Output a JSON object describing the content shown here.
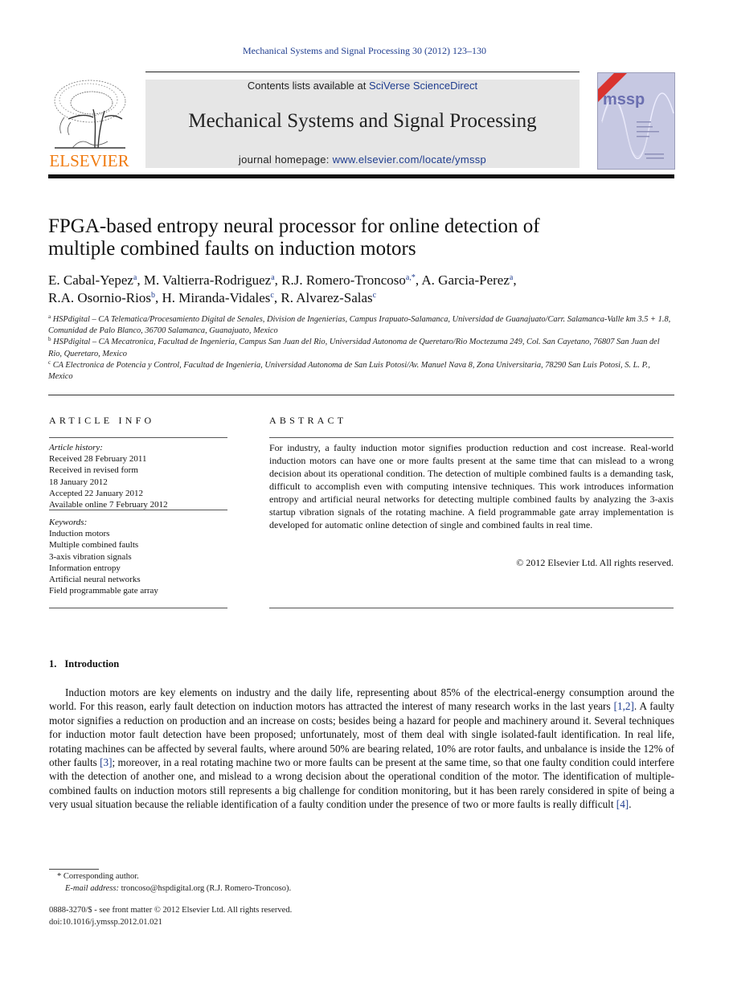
{
  "running_head": "Mechanical Systems and Signal Processing 30 (2012) 123–130",
  "masthead": {
    "publisher_logo_text": "ELSEVIER",
    "contents_prefix": "Contents lists available at ",
    "contents_link": "SciVerse ScienceDirect",
    "journal_title": "Mechanical Systems and Signal Processing",
    "homepage_prefix": "journal homepage: ",
    "homepage_link": "www.elsevier.com/locate/ymssp",
    "cover_title": "mssp"
  },
  "colors": {
    "link": "#1f3d8f",
    "elsevier_orange": "#f07b10",
    "masthead_bg": "#e6e6e6"
  },
  "article": {
    "title_line1": "FPGA-based entropy neural processor for online detection of",
    "title_line2": "multiple combined faults on induction motors",
    "authors": [
      {
        "name": "E. Cabal-Yepez",
        "aff": "a",
        "sep": ", "
      },
      {
        "name": "M. Valtierra-Rodriguez",
        "aff": "a",
        "sep": ", "
      },
      {
        "name": "R.J. Romero-Troncoso",
        "aff": "a,*",
        "sep": ", "
      },
      {
        "name": "A. Garcia-Perez",
        "aff": "a",
        "sep": ","
      },
      {
        "name": "R.A. Osornio-Rios",
        "aff": "b",
        "sep": ", "
      },
      {
        "name": "H. Miranda-Vidales",
        "aff": "c",
        "sep": ", "
      },
      {
        "name": "R. Alvarez-Salas",
        "aff": "c",
        "sep": ""
      }
    ],
    "affiliations": [
      {
        "mark": "a",
        "text": "HSPdigital – CA Telematica/Procesamiento Digital de Senales, Division de Ingenierias, Campus Irapuato-Salamanca, Universidad de Guanajuato/Carr. Salamanca-Valle km 3.5 + 1.8, Comunidad de Palo Blanco, 36700 Salamanca, Guanajuato, Mexico"
      },
      {
        "mark": "b",
        "text": "HSPdigital – CA Mecatronica, Facultad de Ingenieria, Campus San Juan del Rio, Universidad Autonoma de Queretaro/Rio Moctezuma 249, Col. San Cayetano, 76807 San Juan del Rio, Queretaro, Mexico"
      },
      {
        "mark": "c",
        "text": "CA Electronica de Potencia y Control, Facultad de Ingenieria, Universidad Autonoma de San Luis Potosi/Av. Manuel Nava 8, Zona Universitaria, 78290 San Luis Potosi, S. L. P., Mexico"
      }
    ]
  },
  "article_info": {
    "heading": "ARTICLE INFO",
    "history_label": "Article history:",
    "history": [
      "Received 28 February 2011",
      "Received in revised form",
      "18 January 2012",
      "Accepted 22 January 2012",
      "Available online 7 February 2012"
    ],
    "keywords_label": "Keywords:",
    "keywords": [
      "Induction motors",
      "Multiple combined faults",
      "3-axis vibration signals",
      "Information entropy",
      "Artificial neural networks",
      "Field programmable gate array"
    ]
  },
  "abstract": {
    "heading": "ABSTRACT",
    "text": "For industry, a faulty induction motor signifies production reduction and cost increase. Real-world induction motors can have one or more faults present at the same time that can mislead to a wrong decision about its operational condition. The detection of multiple combined faults is a demanding task, difficult to accomplish even with computing intensive techniques. This work introduces information entropy and artificial neural networks for detecting multiple combined faults by analyzing the 3-axis startup vibration signals of the rotating machine. A field programmable gate array implementation is developed for automatic online detection of single and combined faults in real time.",
    "copyright": "© 2012 Elsevier Ltd. All rights reserved."
  },
  "introduction": {
    "number": "1.",
    "title": "Introduction",
    "segments": [
      {
        "t": "Induction motors are key elements on industry and the daily life, representing about 85% of the electrical-energy consumption around the world. For this reason, early fault detection on induction motors has attracted the interest of many research works in the last years "
      },
      {
        "ref": "[1,2]"
      },
      {
        "t": ". A faulty motor signifies a reduction on production and an increase on costs; besides being a hazard for people and machinery around it. Several techniques for induction motor fault detection have been proposed; unfortunately, most of them deal with single isolated-fault identification. In real life, rotating machines can be affected by several faults, where around 50% are bearing related, 10% are rotor faults, and unbalance is inside the 12% of other faults "
      },
      {
        "ref": "[3]"
      },
      {
        "t": "; moreover, in a real rotating machine two or more faults can be present at the same time, so that one faulty condition could interfere with the detection of another one, and mislead to a wrong decision about the operational condition of the motor. The identification of multiple-combined faults on induction motors still represents a big challenge for condition monitoring, but it has been rarely considered in spite of being a very usual situation because the reliable identification of a faulty condition under the presence of two or more faults is really difficult "
      },
      {
        "ref": "[4]"
      },
      {
        "t": "."
      }
    ]
  },
  "footnotes": {
    "corresponding": "* Corresponding author.",
    "email_label": "E-mail address:",
    "email": " troncoso@hspdigital.org (R.J. Romero-Troncoso).",
    "issn": "0888-3270/$ - see front matter © 2012 Elsevier Ltd. All rights reserved.",
    "doi": "doi:10.1016/j.ymssp.2012.01.021"
  }
}
